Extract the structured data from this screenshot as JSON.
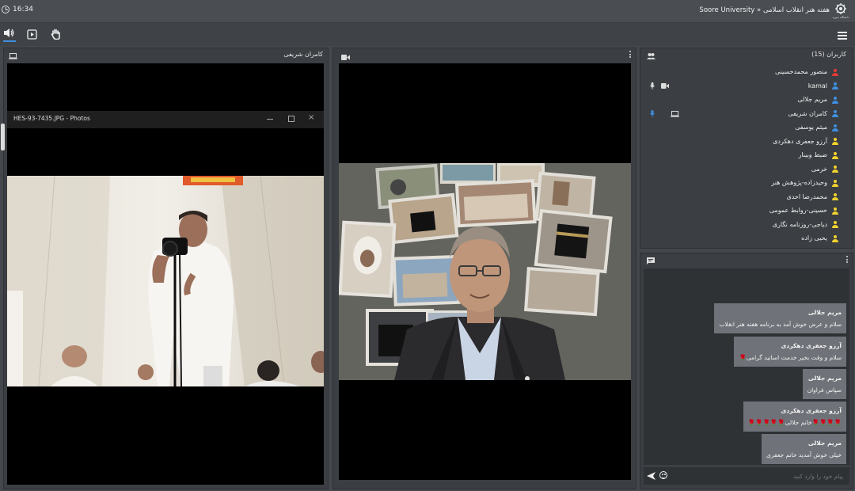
{
  "topbar": {
    "time": "16:34",
    "title": "Soore University » هفته هنر انقلاب اسلامی",
    "logo_text": "دانشگاه سوره"
  },
  "left_panel": {
    "title": "کامران شریفی",
    "photos_window_title": "HES-93-7435.JPG - Photos",
    "photo_description": ""
  },
  "users_panel": {
    "title": "کاربران (15)",
    "users": [
      {
        "name": "منصور محمدحسینی",
        "color": "#e53935",
        "mic": false,
        "cam": false,
        "desk": false
      },
      {
        "name": "kamal",
        "color": "#3f8fe0",
        "mic": true,
        "cam": true,
        "desk": false
      },
      {
        "name": "مریم جلالی",
        "color": "#3f8fe0",
        "mic": false,
        "cam": false,
        "desk": false
      },
      {
        "name": "کامران شریفی",
        "color": "#3f8fe0",
        "mic": true,
        "cam": false,
        "desk": true
      },
      {
        "name": "میثم یوسفی",
        "color": "#3f8fe0",
        "mic": false,
        "cam": false,
        "desk": false
      },
      {
        "name": "آرزو جعفری دهکردی",
        "color": "#f2d22e",
        "mic": false,
        "cam": false,
        "desk": false
      },
      {
        "name": "ضبط وبینار",
        "color": "#f2d22e",
        "mic": false,
        "cam": false,
        "desk": false
      },
      {
        "name": "خرمی",
        "color": "#f2d22e",
        "mic": false,
        "cam": false,
        "desk": false
      },
      {
        "name": "وحیدزاده-پژوهش هنر",
        "color": "#f2d22e",
        "mic": false,
        "cam": false,
        "desk": false
      },
      {
        "name": "محمدرضا احدی",
        "color": "#f2d22e",
        "mic": false,
        "cam": false,
        "desk": false
      },
      {
        "name": "حسینی-روابط عمومی",
        "color": "#f2d22e",
        "mic": false,
        "cam": false,
        "desk": false
      },
      {
        "name": "دیاجی-روزنامه نگاری",
        "color": "#f2d22e",
        "mic": false,
        "cam": false,
        "desk": false
      },
      {
        "name": "یحیی زاده",
        "color": "#f2d22e",
        "mic": false,
        "cam": false,
        "desk": false
      }
    ]
  },
  "chat_panel": {
    "messages": [
      {
        "sender": "مریم جلالی",
        "text": "سلام و عرض خوش آمد به برنامه هفته هنر انقلاب"
      },
      {
        "sender": "آرزو جعفری دهکردی",
        "text": "سلام و وقت بخیر خدمت اساتید گرامی🌹"
      },
      {
        "sender": "مریم جلالی",
        "text": "سپاس فراوان"
      },
      {
        "sender": "آرزو جعفری دهکردی",
        "text": "🌹🌹🌹🌹خانم جلالی🌹🌹🌹🌹🌹"
      },
      {
        "sender": "مریم جلالی",
        "text": "خیلی خوش آمدید خانم جعفری"
      }
    ],
    "input_placeholder": "پیام خود را وارد کنید"
  }
}
